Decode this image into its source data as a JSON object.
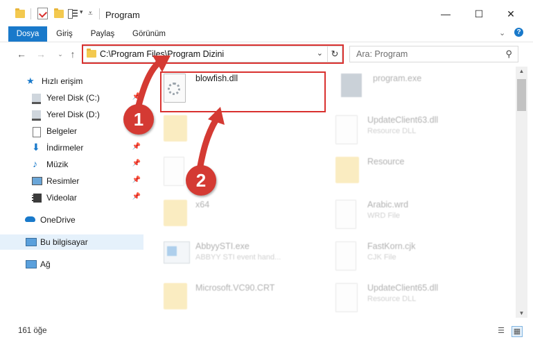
{
  "window": {
    "title": "Program"
  },
  "ribbon": {
    "tabs": [
      "Dosya",
      "Giriş",
      "Paylaş",
      "Görünüm"
    ]
  },
  "address": {
    "path": "C:\\Program Files\\Program Dizini"
  },
  "search": {
    "placeholder": "Ara: Program"
  },
  "nav": {
    "items": [
      {
        "label": "Hızlı erişim",
        "icon": "star-icon"
      },
      {
        "label": "Yerel Disk (C:)",
        "icon": "drive-icon"
      },
      {
        "label": "Yerel Disk (D:)",
        "icon": "drive-icon"
      },
      {
        "label": "Belgeler",
        "icon": "documents-icon"
      },
      {
        "label": "İndirmeler",
        "icon": "download-icon"
      },
      {
        "label": "Müzik",
        "icon": "music-icon"
      },
      {
        "label": "Resimler",
        "icon": "pictures-icon"
      },
      {
        "label": "Videolar",
        "icon": "videos-icon"
      },
      {
        "label": "OneDrive",
        "icon": "cloud-icon"
      },
      {
        "label": "Bu bilgisayar",
        "icon": "computer-icon"
      },
      {
        "label": "Ağ",
        "icon": "network-icon"
      }
    ]
  },
  "files": [
    {
      "name": "blowfish.dll",
      "type": ""
    },
    {
      "name": "program.exe",
      "type": ""
    },
    {
      "name": "UpdateClient63.dll",
      "type": "Resource DLL"
    },
    {
      "name": "Resource",
      "type": ""
    },
    {
      "name": "x64",
      "type": ""
    },
    {
      "name": "Arabic.wrd",
      "type": "WRD File"
    },
    {
      "name": "AbbyySTI.exe",
      "type": "ABBYY STI event hand..."
    },
    {
      "name": "FastKorn.cjk",
      "type": "CJK File"
    },
    {
      "name": "Microsoft.VC90.CRT",
      "type": ""
    },
    {
      "name": "UpdateClient65.dll",
      "type": "Resource DLL"
    }
  ],
  "status": {
    "item_count": "161 öğe"
  },
  "annotations": {
    "badge1": "1",
    "badge2": "2"
  },
  "colors": {
    "accent": "#1979ca",
    "annotation_red": "#d9302e",
    "folder": "#f3c94f"
  }
}
